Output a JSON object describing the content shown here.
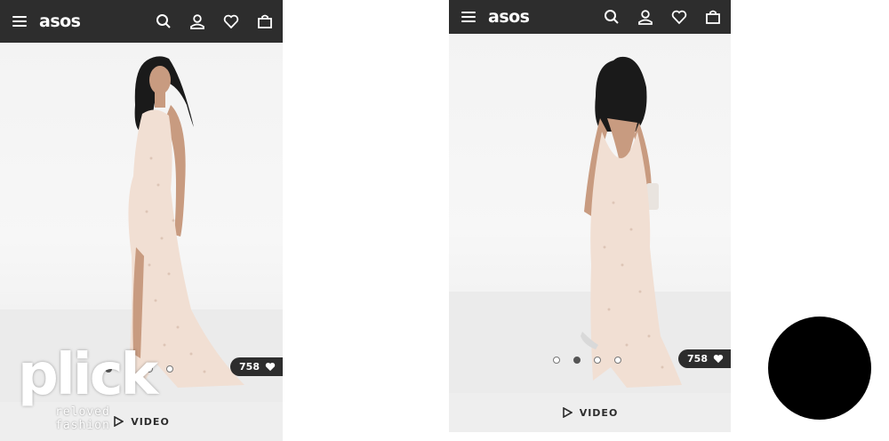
{
  "brand": {
    "logo_text": "asos"
  },
  "icons": [
    "menu-icon",
    "search-icon",
    "account-icon",
    "heart-icon",
    "bag-icon",
    "play-icon"
  ],
  "left_screen": {
    "likes": "758",
    "video_label": "VIDEO",
    "carousel": {
      "count": 4,
      "active_index": 0
    }
  },
  "right_screen": {
    "likes": "758",
    "video_label": "VIDEO",
    "carousel": {
      "count": 4,
      "active_index": 1
    }
  },
  "watermark": {
    "main": "plick",
    "sub": "reloved fashion"
  },
  "colors": {
    "header": "#2d2d2d",
    "video_bar": "#eeeeee",
    "dress": "#f1dfd3",
    "hair": "#1a1a1a"
  }
}
